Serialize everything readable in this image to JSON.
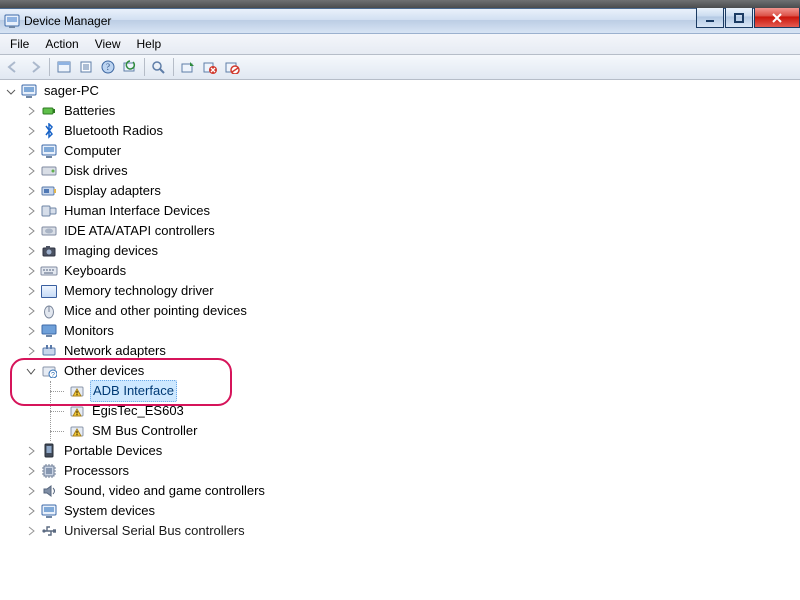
{
  "window": {
    "title": "Device Manager"
  },
  "menu": {
    "file": "File",
    "action": "Action",
    "view": "View",
    "help": "Help"
  },
  "toolbar": {
    "back": "Back",
    "forward": "Forward",
    "show_hidden": "Show hidden devices",
    "properties": "Properties",
    "help": "Help",
    "refresh": "Scan for hardware changes",
    "find": "Find",
    "update_driver": "Update Driver Software",
    "uninstall": "Uninstall",
    "disable": "Disable"
  },
  "tree": {
    "root": "sager-PC",
    "items": [
      "Batteries",
      "Bluetooth Radios",
      "Computer",
      "Disk drives",
      "Display adapters",
      "Human Interface Devices",
      "IDE ATA/ATAPI controllers",
      "Imaging devices",
      "Keyboards",
      "Memory technology driver",
      "Mice and other pointing devices",
      "Monitors",
      "Network adapters",
      "Other devices",
      "Portable Devices",
      "Processors",
      "Sound, video and game controllers",
      "System devices",
      "Universal Serial Bus controllers"
    ],
    "other_children": {
      "adb": "ADB Interface",
      "egis": "EgisTec_ES603",
      "smbus": "SM Bus Controller"
    }
  }
}
